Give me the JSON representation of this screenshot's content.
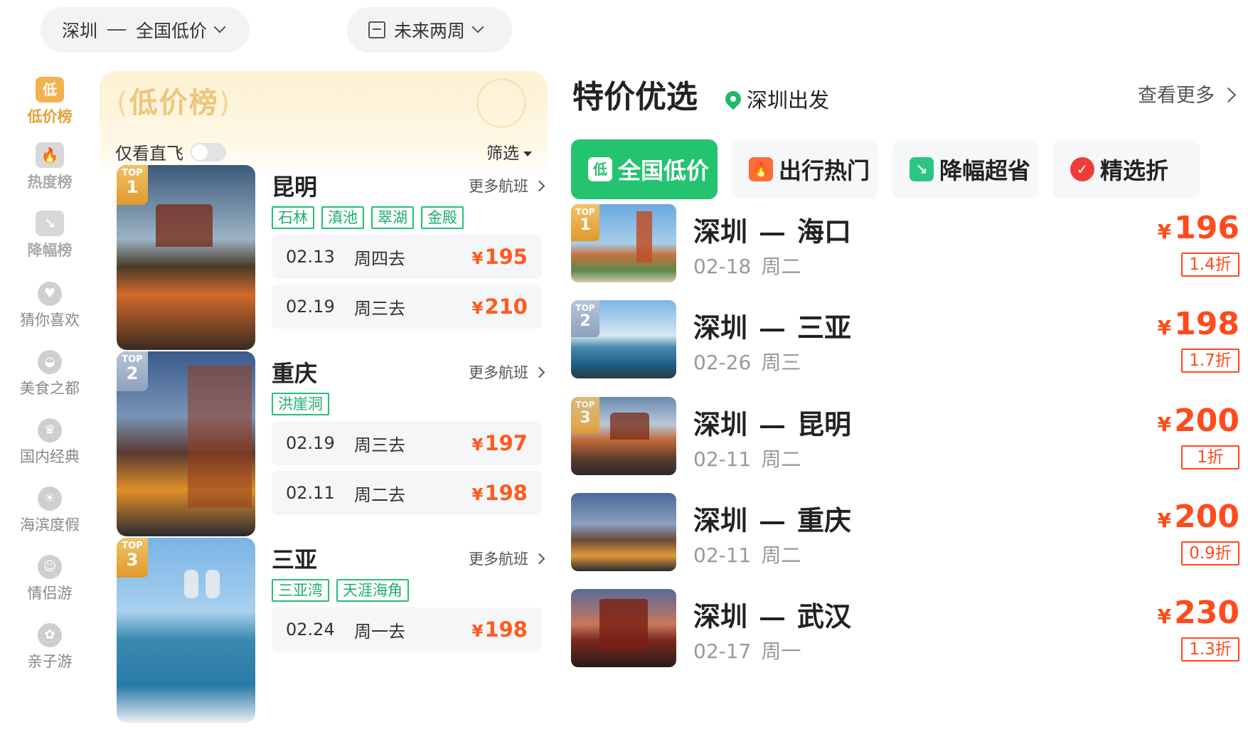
{
  "filters": {
    "origin": "深圳",
    "destination": "全国低价",
    "date_range": "未来两周"
  },
  "sidebar": {
    "items": [
      {
        "badge": "低",
        "label": "低价榜",
        "icon": "low-price-badge-icon",
        "active": true
      },
      {
        "badge": "🔥",
        "label": "热度榜",
        "icon": "fire-badge-icon"
      },
      {
        "badge": "↘",
        "label": "降幅榜",
        "icon": "drop-badge-icon"
      },
      {
        "badge": "♥",
        "label": "猜你喜欢",
        "icon": "heart-icon"
      },
      {
        "badge": "◒",
        "label": "美食之都",
        "icon": "food-dome-icon"
      },
      {
        "badge": "♛",
        "label": "国内经典",
        "icon": "crown-icon"
      },
      {
        "badge": "☀",
        "label": "海滨度假",
        "icon": "beach-icon"
      },
      {
        "badge": "☺",
        "label": "情侣游",
        "icon": "couple-icon"
      },
      {
        "badge": "✿",
        "label": "亲子游",
        "icon": "family-icon"
      }
    ]
  },
  "ranking": {
    "title": "低价榜",
    "bracket_left": "(",
    "bracket_right": ")",
    "direct_only_label": "仅看直飞",
    "direct_only_on": false,
    "filter_label": "筛选",
    "more_flights_label": "更多航班",
    "top_label": "TOP",
    "cards": [
      {
        "rank": "1",
        "city": "昆明",
        "tags": [
          "石林",
          "滇池",
          "翠湖",
          "金殿"
        ],
        "fares": [
          {
            "date": "02.13",
            "day": "周四去",
            "currency": "¥",
            "price": "195"
          },
          {
            "date": "02.19",
            "day": "周三去",
            "currency": "¥",
            "price": "210"
          }
        ]
      },
      {
        "rank": "2",
        "city": "重庆",
        "tags": [
          "洪崖洞"
        ],
        "fares": [
          {
            "date": "02.19",
            "day": "周三去",
            "currency": "¥",
            "price": "197"
          },
          {
            "date": "02.11",
            "day": "周二去",
            "currency": "¥",
            "price": "198"
          }
        ]
      },
      {
        "rank": "3",
        "city": "三亚",
        "tags": [
          "三亚湾",
          "天涯海角"
        ],
        "fares": [
          {
            "date": "02.24",
            "day": "周一去",
            "currency": "¥",
            "price": "198"
          }
        ]
      }
    ]
  },
  "deals": {
    "title": "特价优选",
    "departure": "深圳出发",
    "see_more": "查看更多",
    "tabs": [
      {
        "icon_text": "低",
        "label": "全国低价",
        "active": true
      },
      {
        "icon_text": "🔥",
        "label": "出行热门"
      },
      {
        "icon_text": "↘",
        "label": "降幅超省"
      },
      {
        "icon_text": "✓",
        "label": "精选折"
      }
    ],
    "items": [
      {
        "rank": "1",
        "from": "深圳",
        "to": "海口",
        "date": "02-18",
        "weekday": "周二",
        "currency": "¥",
        "price": "196",
        "discount": "1.4折"
      },
      {
        "rank": "2",
        "from": "深圳",
        "to": "三亚",
        "date": "02-26",
        "weekday": "周三",
        "currency": "¥",
        "price": "198",
        "discount": "1.7折"
      },
      {
        "rank": "3",
        "from": "深圳",
        "to": "昆明",
        "date": "02-11",
        "weekday": "周二",
        "currency": "¥",
        "price": "200",
        "discount": "1折"
      },
      {
        "rank": "",
        "from": "深圳",
        "to": "重庆",
        "date": "02-11",
        "weekday": "周二",
        "currency": "¥",
        "price": "200",
        "discount": "0.9折"
      },
      {
        "rank": "",
        "from": "深圳",
        "to": "武汉",
        "date": "02-17",
        "weekday": "周一",
        "currency": "¥",
        "price": "230",
        "discount": "1.3折"
      }
    ]
  },
  "colors": {
    "accent_green": "#24c36f",
    "price_orange": "#ff4a1c",
    "gold": "#e1a13a"
  }
}
